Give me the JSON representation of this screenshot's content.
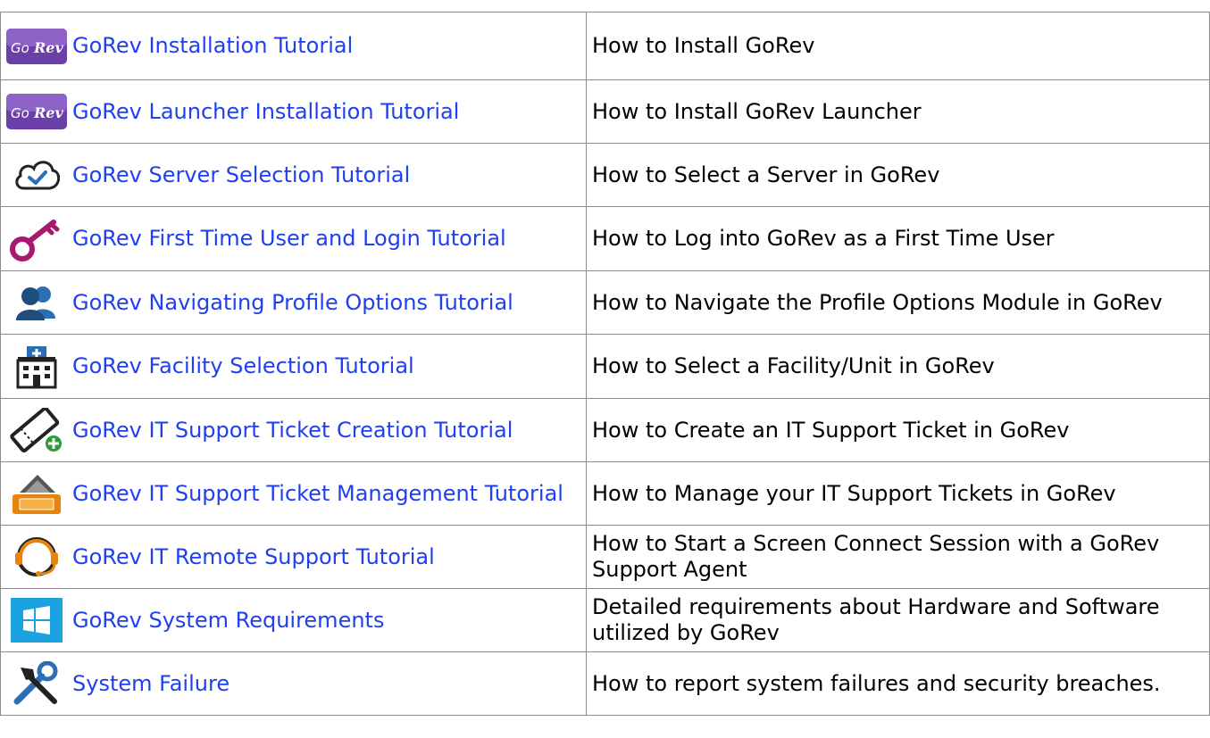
{
  "rows": [
    {
      "icon": "gorev-logo-icon",
      "link": "GoRev Installation Tutorial",
      "desc": "How to Install GoRev"
    },
    {
      "icon": "gorev-logo-icon",
      "link": "GoRev Launcher Installation Tutorial",
      "desc": "How to Install GoRev Launcher"
    },
    {
      "icon": "cloud-check-icon",
      "link": "GoRev Server Selection Tutorial",
      "desc": "How to Select a Server in GoRev"
    },
    {
      "icon": "key-icon",
      "link": "GoRev First Time User and Login Tutorial",
      "desc": "How to Log into GoRev as a First Time User"
    },
    {
      "icon": "users-icon",
      "link": "GoRev Navigating Profile Options Tutorial",
      "desc": "How to Navigate the Profile Options Module in GoRev"
    },
    {
      "icon": "hospital-icon",
      "link": "GoRev Facility Selection Tutorial",
      "desc": "How to Select a Facility/Unit in GoRev"
    },
    {
      "icon": "ticket-add-icon",
      "link": "GoRev IT Support Ticket Creation Tutorial",
      "desc": "How to Create an IT Support Ticket in GoRev"
    },
    {
      "icon": "ticket-stack-icon",
      "link": "GoRev IT Support Ticket Management Tutorial",
      "desc": "How to Manage your IT Support Tickets in GoRev"
    },
    {
      "icon": "headset-icon",
      "link": "GoRev IT Remote Support Tutorial",
      "desc": "How to Start a Screen Connect Session with a GoRev Support Agent"
    },
    {
      "icon": "windows-icon",
      "link": "GoRev System Requirements",
      "desc": "Detailed requirements about Hardware and Software utilized by GoRev"
    },
    {
      "icon": "tools-icon",
      "link": "System Failure",
      "desc": "How to report system failures and security breaches."
    }
  ],
  "colors": {
    "link": "#1f3ff0",
    "border": "#8c8c8c",
    "gorev_purple": "#7b4fb8",
    "key_magenta": "#a8186e",
    "users_blue": "#2d5f93",
    "hospital_blue": "#2a6fb3",
    "ticket_orange": "#e8830b",
    "windows_blue": "#1aa3e0",
    "plus_green": "#2f9a3a"
  }
}
